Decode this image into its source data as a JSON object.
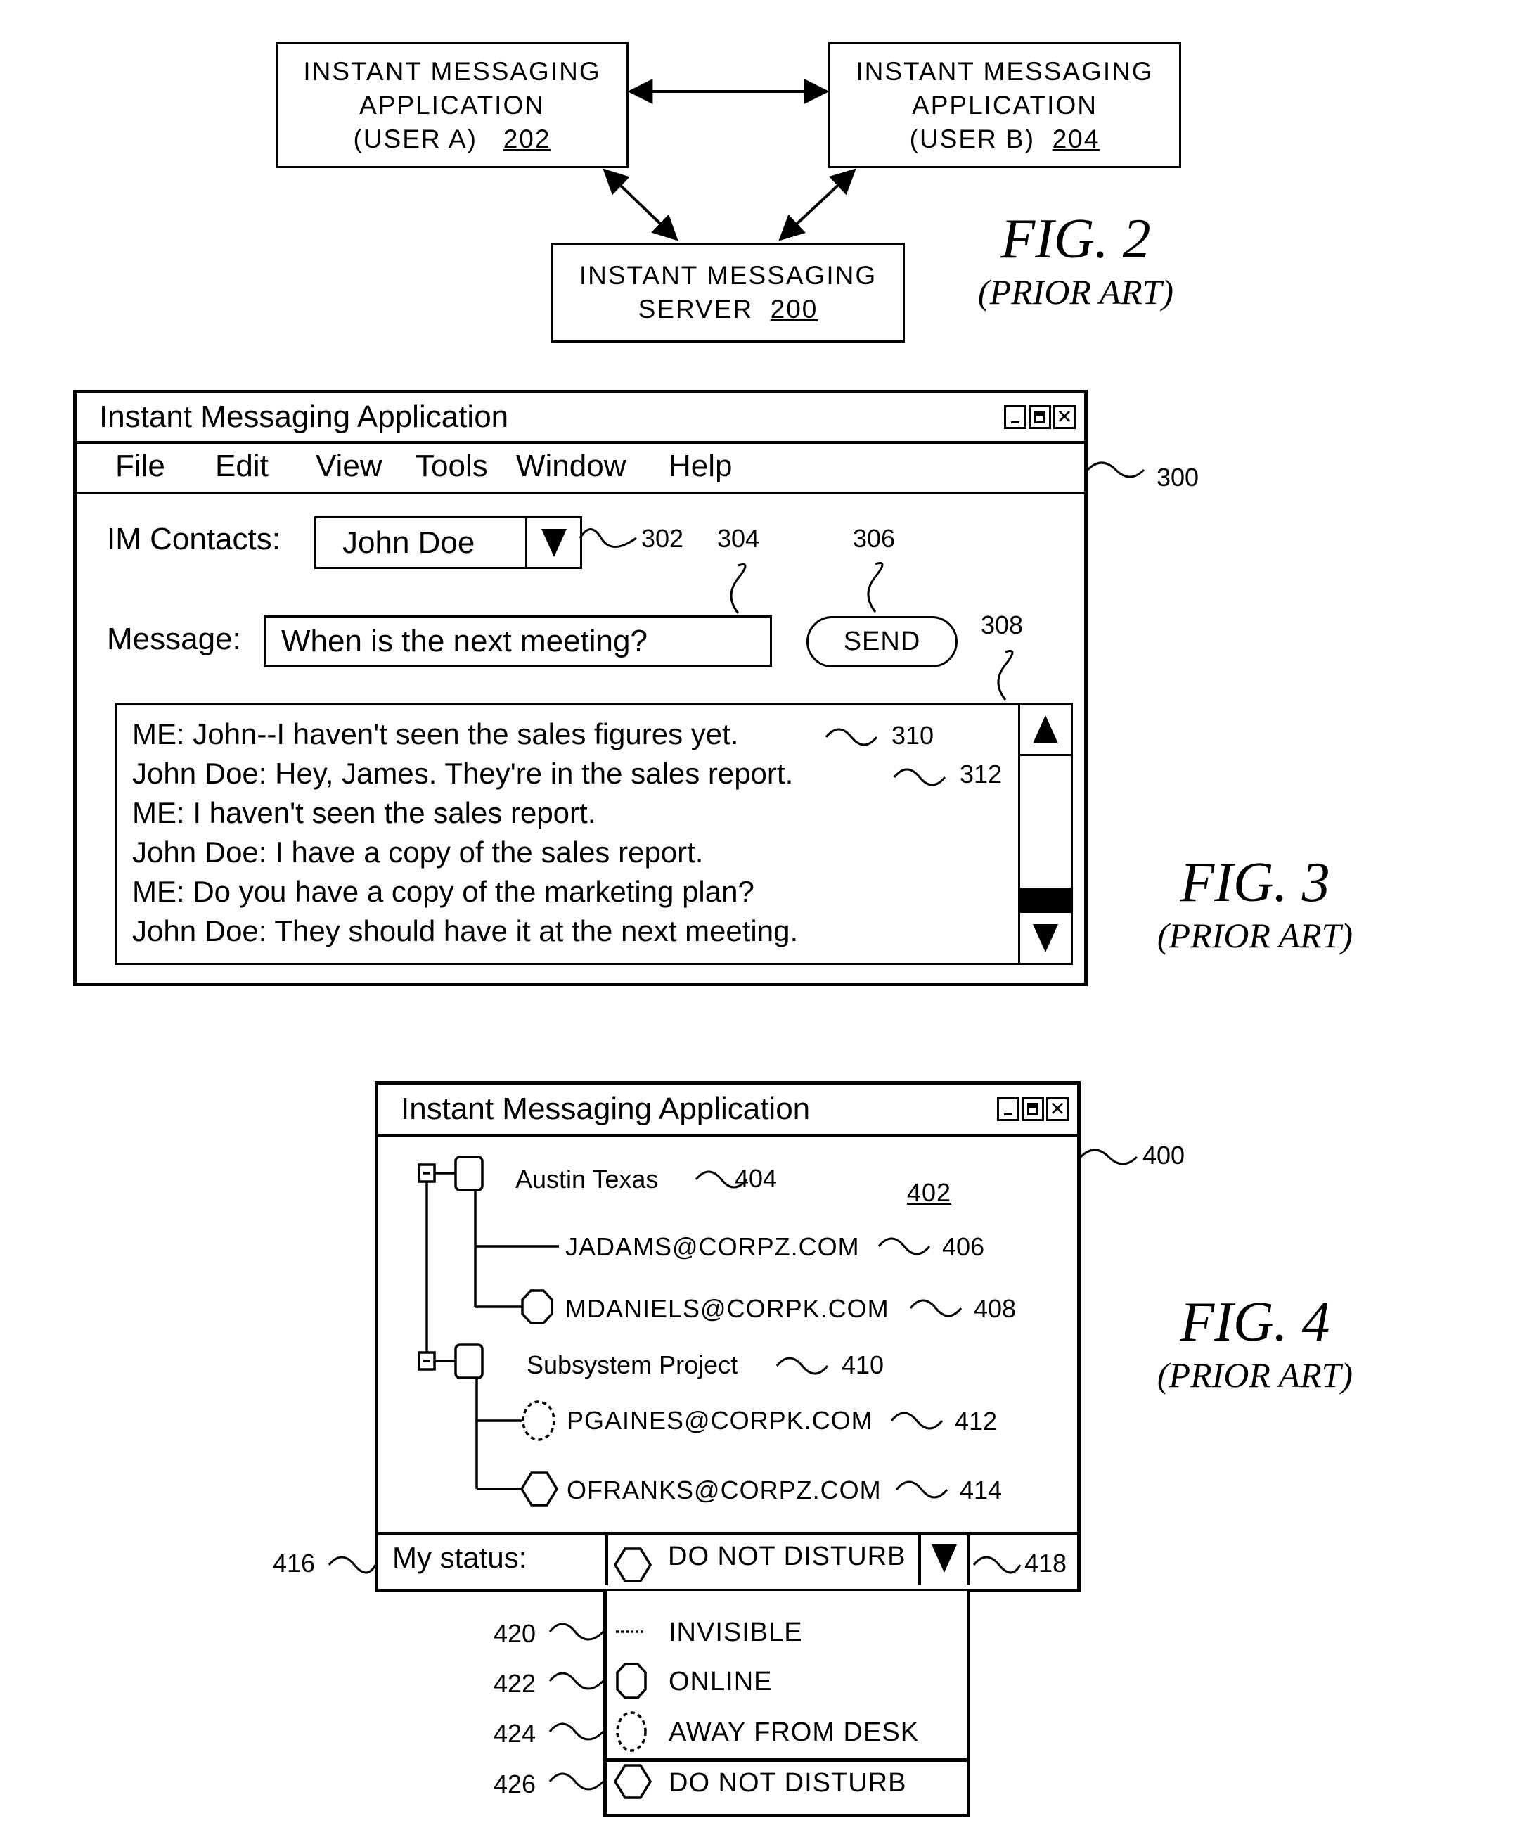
{
  "fig2": {
    "box_a": {
      "lines": [
        "INSTANT MESSAGING",
        "APPLICATION"
      ],
      "sub": "(USER A)",
      "ref": "202"
    },
    "box_b": {
      "lines": [
        "INSTANT MESSAGING",
        "APPLICATION"
      ],
      "sub": "(USER B)",
      "ref": "204"
    },
    "server": {
      "line1": "INSTANT MESSAGING",
      "sub": "SERVER",
      "ref": "200"
    },
    "caption": "FIG. 2",
    "subcaption": "(PRIOR ART)"
  },
  "fig3": {
    "window_title": "Instant Messaging Application",
    "window_ref": "300",
    "menu": [
      "File",
      "Edit",
      "View",
      "Tools",
      "Window",
      "Help"
    ],
    "contacts_label": "IM Contacts:",
    "contacts_value": "John Doe",
    "contacts_ref": "302",
    "message_label": "Message:",
    "message_value": "When is the next meeting?",
    "message_ref": "304",
    "send_label": "SEND",
    "send_ref": "306",
    "chat_ref": "308",
    "chat_lines": [
      {
        "text": "ME: John--I haven't seen the sales figures yet.",
        "ref": "310"
      },
      {
        "text": "John Doe: Hey, James.  They're in the sales report.",
        "ref": "312"
      },
      {
        "text": "ME:  I haven't seen the sales report.",
        "ref": ""
      },
      {
        "text": "John Doe: I have a copy of the sales report.",
        "ref": ""
      },
      {
        "text": "ME: Do you have a copy of the marketing plan?",
        "ref": ""
      },
      {
        "text": "John Doe: They should have it at the next meeting.",
        "ref": ""
      }
    ],
    "caption": "FIG. 3",
    "subcaption": "(PRIOR ART)"
  },
  "fig4": {
    "window_title": "Instant Messaging Application",
    "window_ref": "400",
    "pane_ref": "402",
    "groups": [
      {
        "name": "Austin Texas",
        "ref": "404",
        "contacts": [
          {
            "email": "JADAMS@CORPZ.COM",
            "status": "invisible",
            "ref": "406"
          },
          {
            "email": "MDANIELS@CORPK.COM",
            "status": "online",
            "ref": "408"
          }
        ]
      },
      {
        "name": "Subsystem Project",
        "ref": "410",
        "contacts": [
          {
            "email": "PGAINES@CORPK.COM",
            "status": "away",
            "ref": "412"
          },
          {
            "email": "OFRANKS@CORPZ.COM",
            "status": "do-not-disturb",
            "ref": "414"
          }
        ]
      }
    ],
    "status_label": "My status:",
    "status_label_ref": "416",
    "status_value": "DO NOT DISTURB",
    "status_dropdown_ref": "418",
    "options": [
      {
        "label": "INVISIBLE",
        "icon": "dashed-line-icon",
        "ref": "420"
      },
      {
        "label": "ONLINE",
        "icon": "octagon-icon",
        "ref": "422"
      },
      {
        "label": "AWAY FROM DESK",
        "icon": "dashed-circle-icon",
        "ref": "424"
      },
      {
        "label": "DO NOT DISTURB",
        "icon": "hexagon-icon",
        "ref": "426"
      }
    ],
    "caption": "FIG. 4",
    "subcaption": "(PRIOR ART)"
  }
}
